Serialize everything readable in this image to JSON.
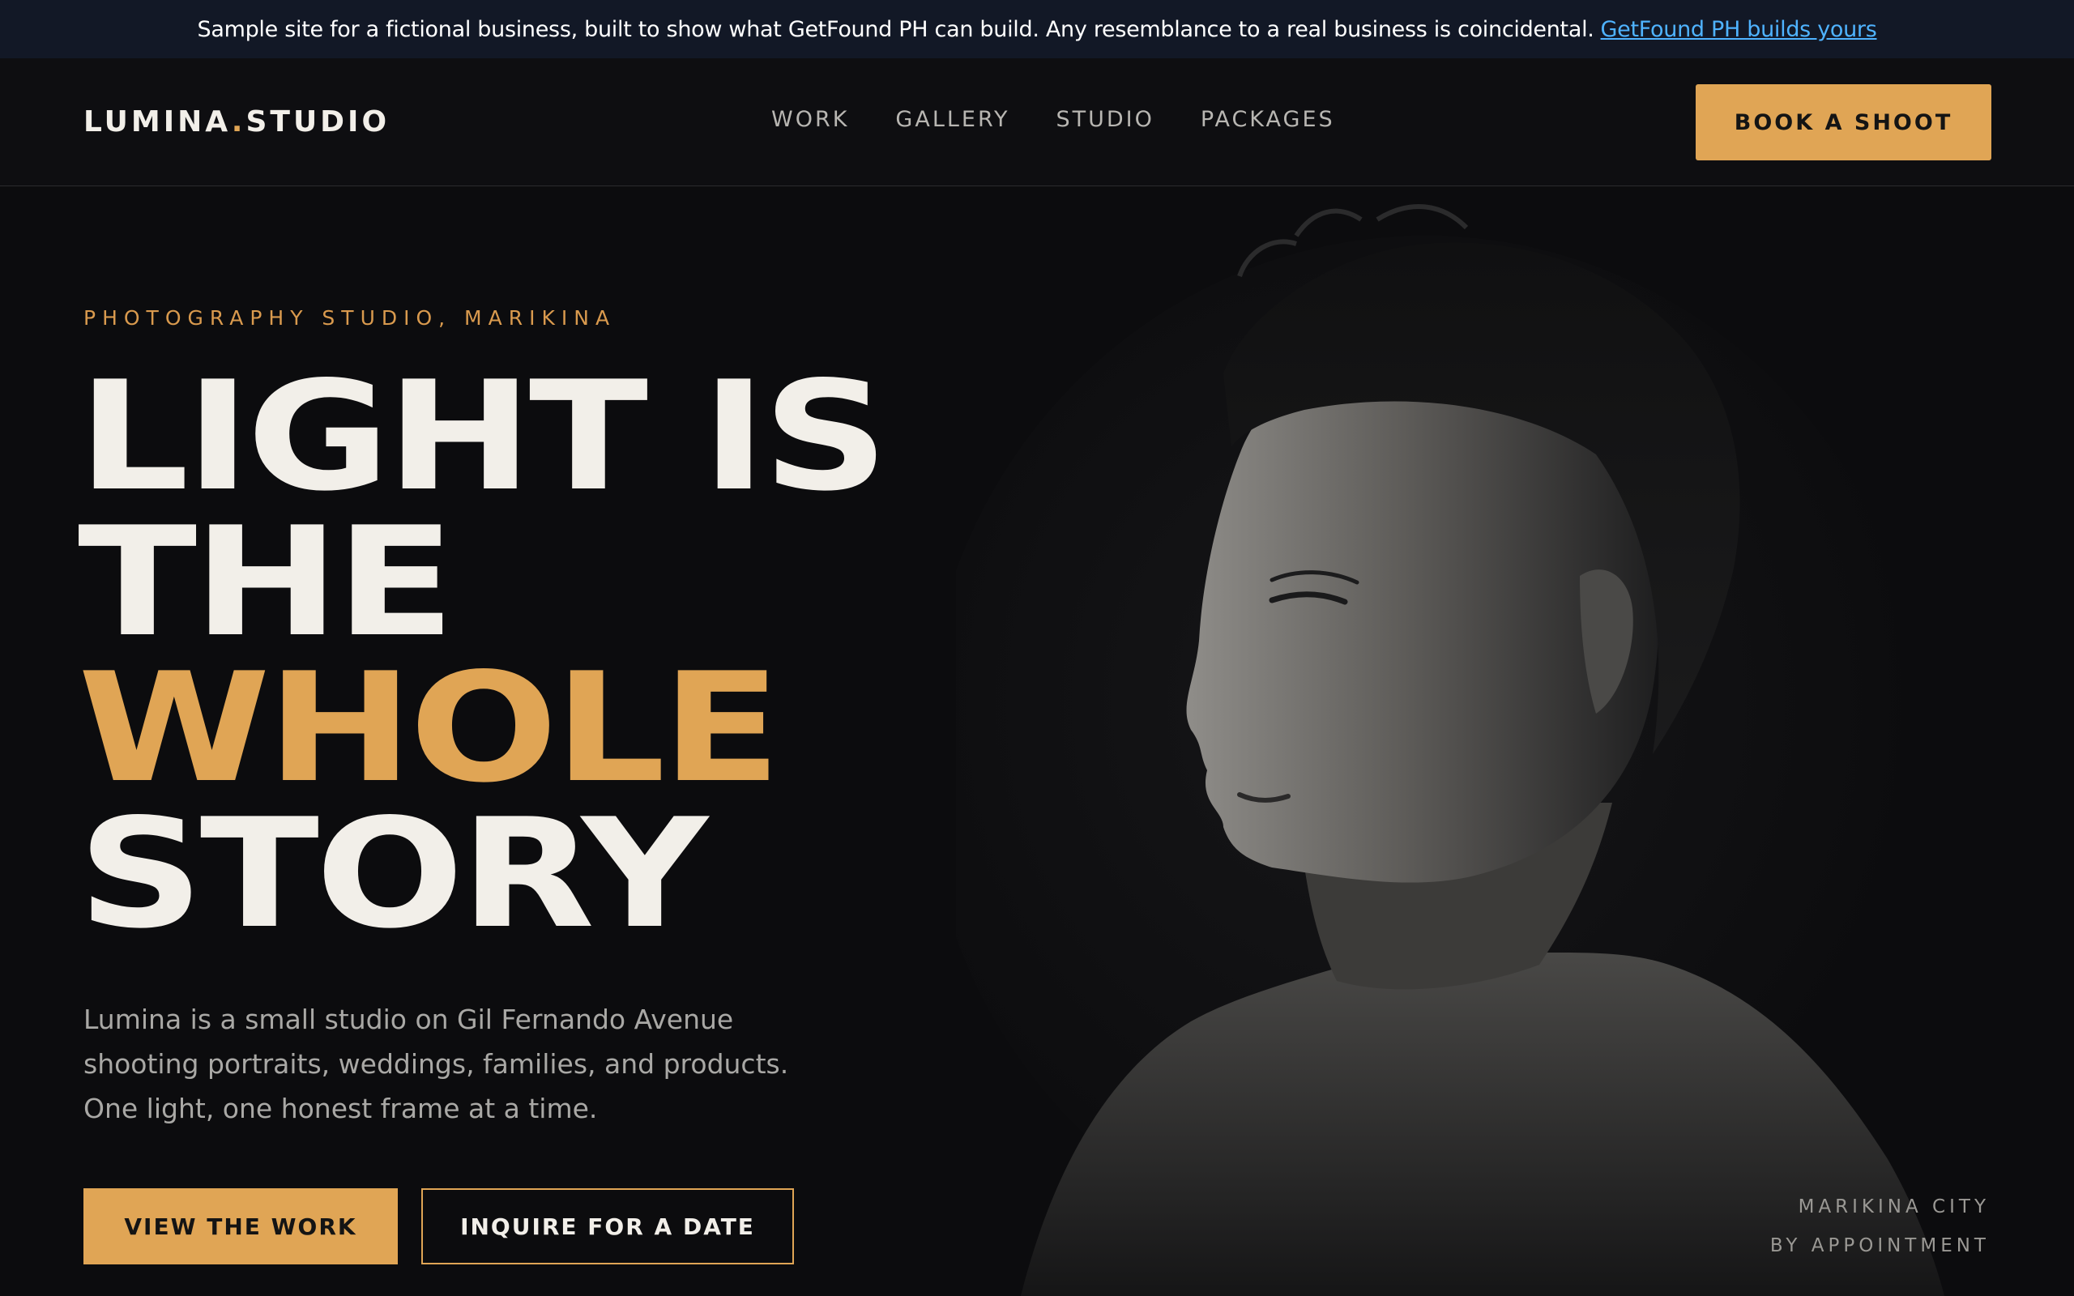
{
  "banner": {
    "text": "Sample site for a fictional business, built to show what GetFound PH can build. Any resemblance to a real business is coincidental.",
    "link_label": "GetFound PH builds yours"
  },
  "nav": {
    "logo_left": "LUMINA",
    "logo_dot": ".",
    "logo_right": "STUDIO",
    "links": [
      "WORK",
      "GALLERY",
      "STUDIO",
      "PACKAGES"
    ],
    "cta_label": "BOOK A SHOOT"
  },
  "hero": {
    "eyebrow": "PHOTOGRAPHY STUDIO, MARIKINA",
    "headline": [
      "LIGHT IS",
      "THE",
      "WHOLE",
      "STORY"
    ],
    "lede": "Lumina is a small studio on Gil Fernando Avenue shooting portraits, weddings, families, and products. One light, one honest frame at a time.",
    "primary_cta": "VIEW THE WORK",
    "secondary_cta": "INQUIRE FOR A DATE",
    "location_line1": "MARIKINA CITY",
    "location_line2": "BY APPOINTMENT"
  },
  "colors": {
    "accent": "#e0a555",
    "background": "#0d0d0f",
    "banner_bg": "#121826",
    "link": "#4fb3ff"
  }
}
